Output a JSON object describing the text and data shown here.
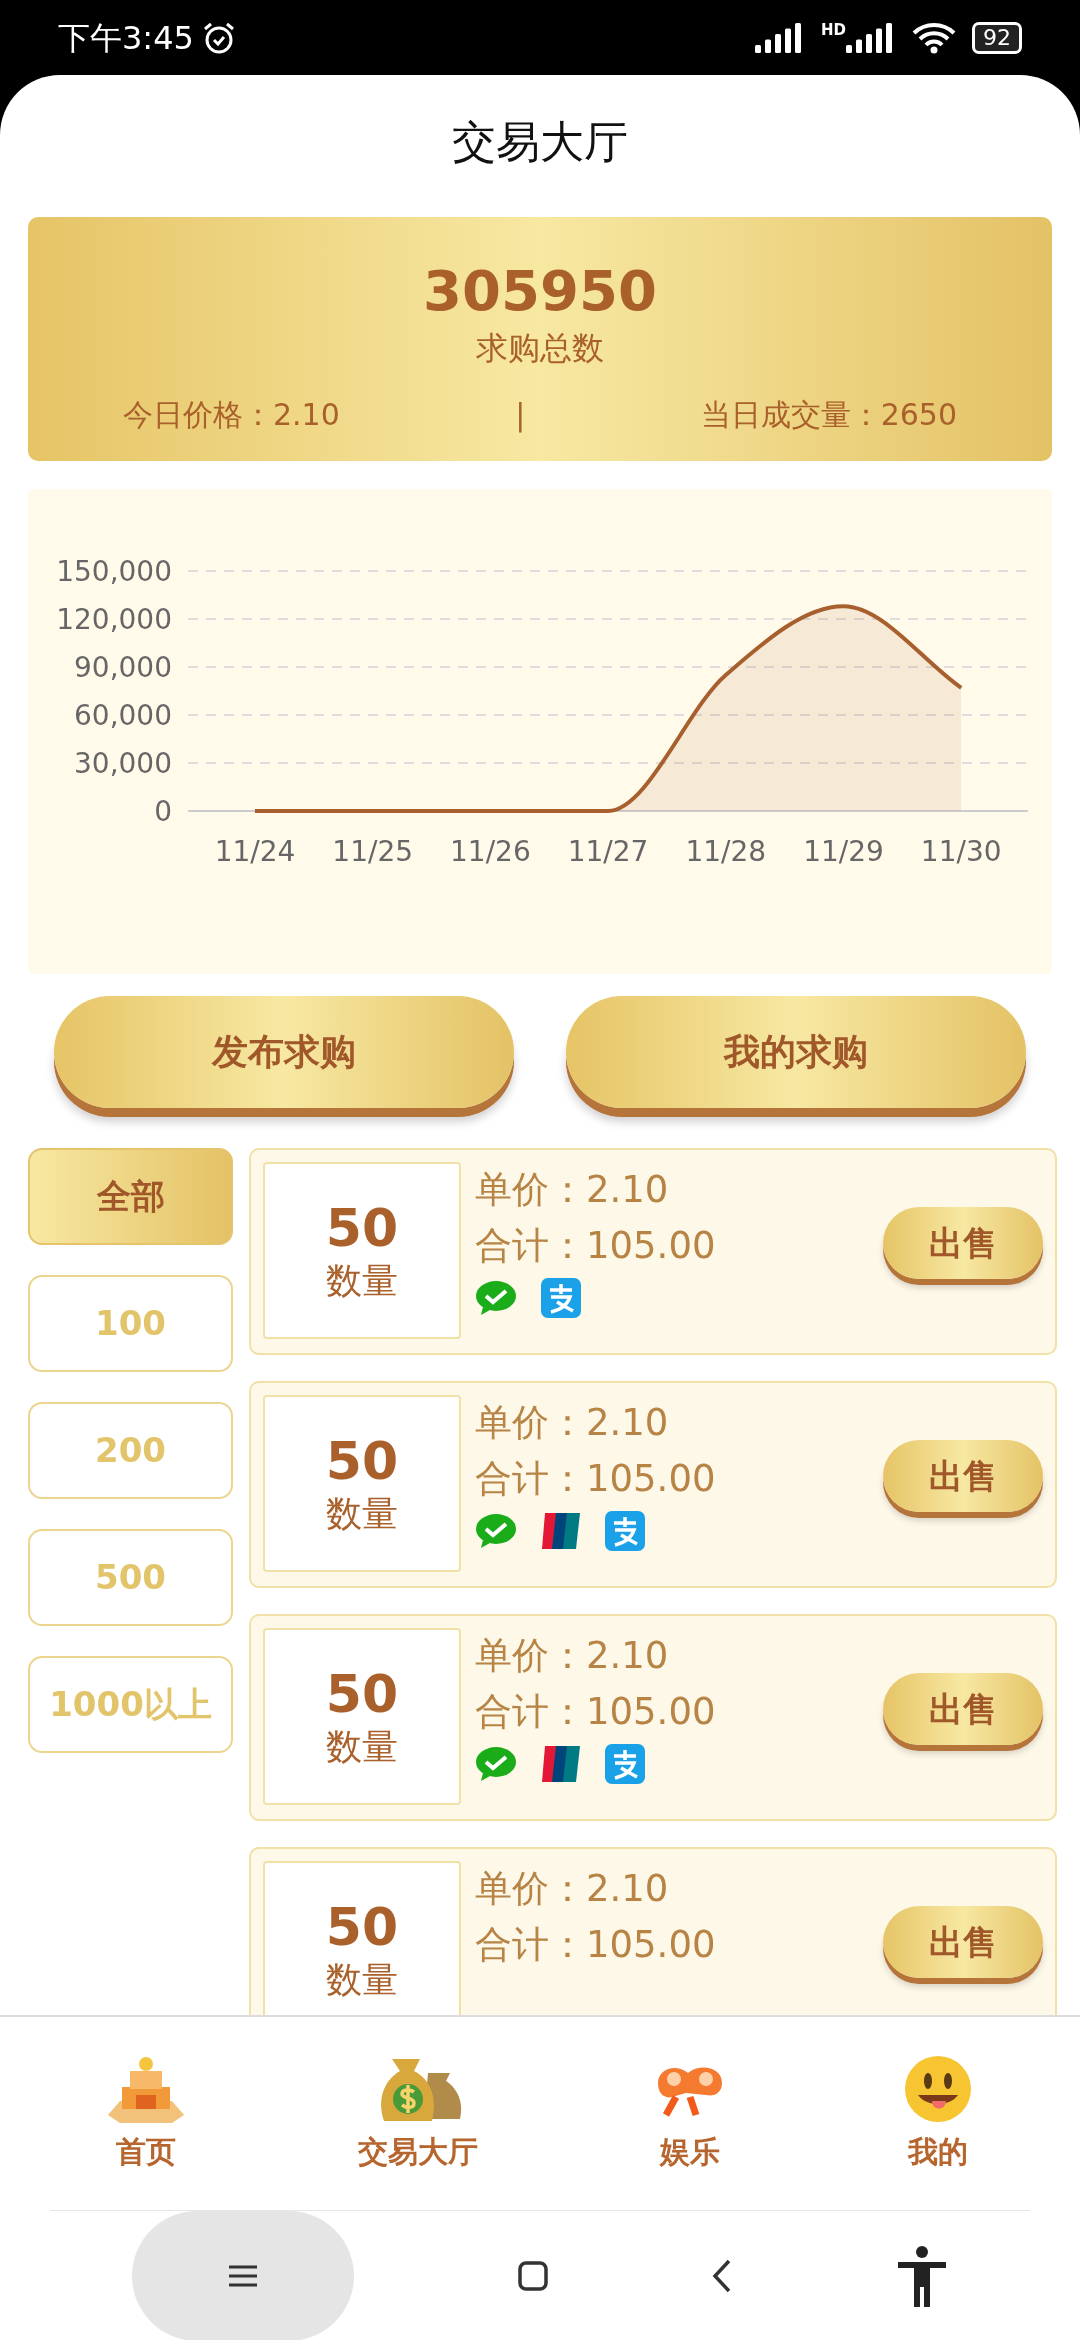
{
  "status_bar": {
    "time": "下午3:45",
    "network": "HD",
    "battery": "92"
  },
  "header": {
    "title": "交易大厅"
  },
  "summary": {
    "total": "305950",
    "total_label": "求购总数",
    "price_label": "今日价格：2.10",
    "separator": "|",
    "volume_label": "当日成交量：2650"
  },
  "chart": {
    "chart_data": {
      "type": "area",
      "categories": [
        "11/24",
        "11/25",
        "11/26",
        "11/27",
        "11/28",
        "11/29",
        "11/30"
      ],
      "grid": true,
      "series": [
        {
          "color": "#a85f2e",
          "values": [
            0,
            0,
            0,
            0,
            85000,
            128000,
            77000
          ]
        }
      ],
      "ylim": [
        0,
        150000
      ],
      "yticks": [
        {
          "value": 0,
          "label": "0"
        },
        {
          "value": 30000,
          "label": "30,000"
        },
        {
          "value": 60000,
          "label": "60,000"
        },
        {
          "value": 90000,
          "label": "90,000"
        },
        {
          "value": 120000,
          "label": "120,000"
        },
        {
          "value": 150000,
          "label": "150,000"
        }
      ]
    }
  },
  "actions": [
    "发布求购",
    "我的求购"
  ],
  "filters": [
    {
      "label": "全部",
      "selected": true
    },
    {
      "label": "100",
      "selected": false
    },
    {
      "label": "200",
      "selected": false
    },
    {
      "label": "500",
      "selected": false
    },
    {
      "label": "1000以上",
      "selected": false
    }
  ],
  "orders": [
    {
      "quantity": "50",
      "quantity_label": "数量",
      "price": "单价：2.10",
      "total": "合计：105.00",
      "payments": [
        {
          "kind": "wechat"
        },
        {
          "kind": "alipay"
        }
      ],
      "action": "出售"
    },
    {
      "quantity": "50",
      "quantity_label": "数量",
      "price": "单价：2.10",
      "total": "合计：105.00",
      "payments": [
        {
          "kind": "wechat"
        },
        {
          "kind": "unionpay"
        },
        {
          "kind": "alipay"
        }
      ],
      "action": "出售"
    },
    {
      "quantity": "50",
      "quantity_label": "数量",
      "price": "单价：2.10",
      "total": "合计：105.00",
      "payments": [
        {
          "kind": "wechat"
        },
        {
          "kind": "unionpay"
        },
        {
          "kind": "alipay"
        }
      ],
      "action": "出售"
    },
    {
      "quantity": "50",
      "quantity_label": "数量",
      "price": "单价：2.10",
      "total": "合计：105.00",
      "action": "出售"
    }
  ],
  "tabs": [
    {
      "label": "首页",
      "kind": "home"
    },
    {
      "label": "交易大厅",
      "kind": "money"
    },
    {
      "label": "娱乐",
      "kind": "game"
    },
    {
      "label": "我的",
      "kind": "face"
    }
  ]
}
